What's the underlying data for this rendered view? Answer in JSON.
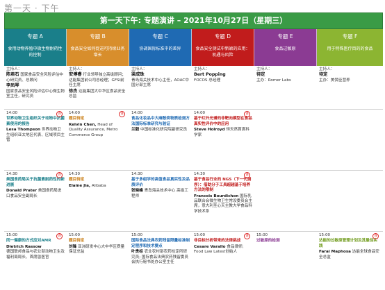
{
  "day_label": "第一天 · 下午",
  "title": "第一天下午: 专题演讲 – 2021年10月27日（星期三）",
  "interpretation_icon": "simultaneous-interpretation-icon",
  "colors": {
    "title_bar": "#3a9b46",
    "tracks": [
      "#1a7f8a",
      "#d88e2c",
      "#1f6ab3",
      "#c11c1c",
      "#8b3b93",
      "#8cb532"
    ]
  },
  "tracks": [
    {
      "label": "专题 A",
      "topic": "食用动物养殖中微生物耐药性的控制"
    },
    {
      "label": "专题 B",
      "topic": "食品安全如何促进可持续业务增长"
    },
    {
      "label": "专题 C",
      "topic": "协调国际标准中的差异"
    },
    {
      "label": "专题 D",
      "topic": "食品安全测试中新颖的应用：机遇与风险"
    },
    {
      "label": "专题 E",
      "topic": "食品过敏原"
    },
    {
      "label": "专题 F",
      "topic": "用于特殊医疗目的的食品"
    }
  ],
  "chairs": [
    {
      "head": "主持人：",
      "name": "陈君石",
      "aff": "国家食品安全风险评估中心研究员、总顾问",
      "name2": "李凤琴",
      "aff2": "国家食品安全风险评估中心微生物室主任，研究员"
    },
    {
      "head": "主持人：",
      "name": "安博睿",
      "aff": "行业领导独立高级顾问；达能集团前公司总经理；GFSI前任主席",
      "name2": "徐杰",
      "aff2": "达能集团大中华区食品安全总监"
    },
    {
      "head": "主持人：",
      "name": "梁成珠",
      "aff": "青岛海关技术中心主任，AOAC中国分部主席",
      "name2": "",
      "aff2": ""
    },
    {
      "head": "主持人：",
      "name": "Bert Popping",
      "aff": "FOCOS 总经理",
      "name2": "",
      "aff2": ""
    },
    {
      "head": "主持人：",
      "name": "待定",
      "aff": "主办：Romer Labs",
      "name2": "",
      "aff2": ""
    },
    {
      "head": "主持人：",
      "name": "待定",
      "aff": "主办：美赞臣营养",
      "name2": "",
      "aff2": ""
    }
  ],
  "slots": [
    [
      {
        "time": "14:00",
        "topic": "世界动物卫生组织关于动物中抗菌素使用的报告",
        "speaker": "Lesa Thompson",
        "aff": "世界动物卫生组织亚太地区代表、区域项目主管"
      },
      {
        "time": "14:00",
        "topic": "题目待定",
        "speaker": "Kelvin Chen,",
        "aff": "Head of Quality Assurance, Metro Commerce Group"
      },
      {
        "time": "14:00",
        "topic": "食品化妆品中大麻酚类物质检测方法国际标准研究与验证",
        "speaker": "兰毅",
        "aff": "中国标准化研究院副研究员"
      },
      {
        "time": "14:00",
        "topic": "基于红外光谱的非靶向模型在食品真实性评价中的应用",
        "speaker": "Steve Holroyd",
        "aff": "恒天然首席科学家"
      },
      {
        "time": "",
        "topic": "",
        "speaker": "",
        "aff": ""
      },
      {
        "time": "",
        "topic": "",
        "speaker": "",
        "aff": ""
      }
    ],
    [
      {
        "time": "14:30",
        "topic": "美国食药局关于抗菌素耐药性的新进展",
        "speaker": "Donald Prater",
        "aff": "美国食药局进口食品安全副局长"
      },
      {
        "time": "14:30",
        "topic": "题目待定",
        "speaker": "Elaine Jia,",
        "aff": "Alibaba"
      },
      {
        "time": "14:30",
        "topic": "基于多组学的高值食品真实性及品质评价",
        "speaker": "张晓峰",
        "aff": "青岛海关技术中心 高级工程师"
      },
      {
        "time": "14:30",
        "topic": "基于食品行业的 NGS（下一代测序）：借助分子工具超越基于培养方法的限制",
        "speaker": "Francois Bourdichon",
        "aff": "国际乳品联合会微生物卫生常设委员会主席，意大利圣心天主教大学食品科学技术系"
      },
      {
        "time": "",
        "topic": "",
        "speaker": "",
        "aff": ""
      },
      {
        "time": "",
        "topic": "",
        "speaker": "",
        "aff": ""
      }
    ],
    [
      {
        "time": "15:00",
        "topic": "同一健康的方式应对AMR",
        "speaker": "Dietrich Rassow",
        "aff": "德国联邦食品与农业部动物卫生及福利局局长、首席兽医官"
      },
      {
        "time": "15:00",
        "topic": "题目待定",
        "speaker": "刘锋",
        "aff": "亚洲研发中心大中华区质量保证总监"
      },
      {
        "time": "15:00",
        "topic": "国际食品法典农药残留限量标准制定程序和技术要点",
        "speaker": "叶贵标",
        "aff": "农业农村部农药检定所研究员; 国际食品法典农药残留委员会执行秘书处办公室主任"
      },
      {
        "time": "15:00",
        "topic": "非目标分析带来的法律挑战",
        "speaker": "Cesare Varallo",
        "aff": "食品律师; Food Law Latest创始人"
      },
      {
        "time": "15:00",
        "topic": "过敏原的检测",
        "speaker": "",
        "aff": ""
      },
      {
        "time": "15:00",
        "topic": "达能的过敏原管理计划及其最佳实践",
        "speaker": "Farai Maphosa",
        "aff": "达能全球食品安全总监"
      }
    ]
  ]
}
